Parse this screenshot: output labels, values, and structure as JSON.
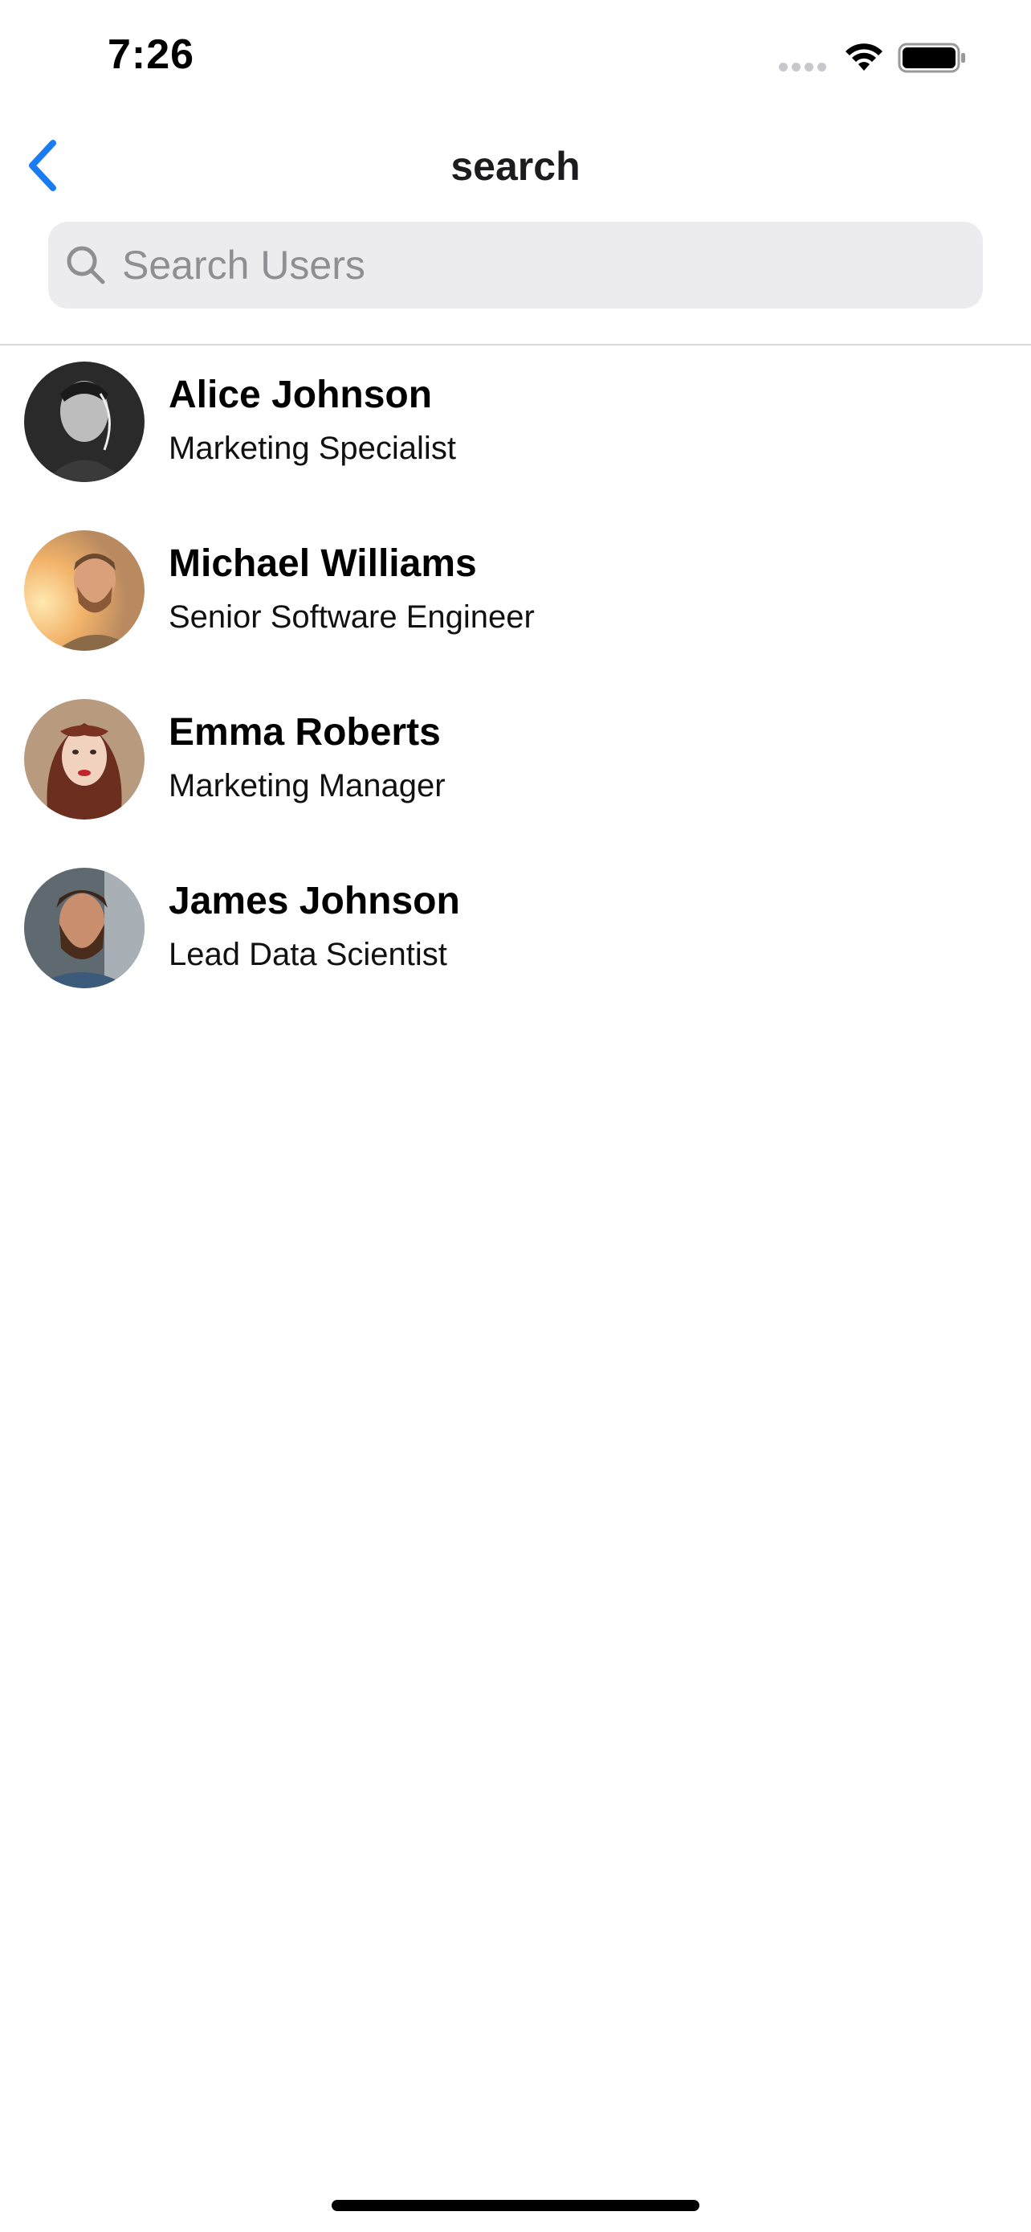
{
  "status_bar": {
    "time": "7:26",
    "icons": [
      "signal-dots-icon",
      "wifi-icon",
      "battery-icon"
    ]
  },
  "nav": {
    "title": "search",
    "back_icon": "chevron-left-icon",
    "accent_color": "#1a7cf2"
  },
  "search": {
    "placeholder": "Search Users",
    "value": "",
    "icon": "search-icon"
  },
  "users": [
    {
      "name": "Alice Johnson",
      "title": "Marketing Specialist"
    },
    {
      "name": "Michael Williams",
      "title": "Senior Software Engineer"
    },
    {
      "name": "Emma Roberts",
      "title": "Marketing Manager"
    },
    {
      "name": "James Johnson",
      "title": "Lead Data Scientist"
    }
  ]
}
